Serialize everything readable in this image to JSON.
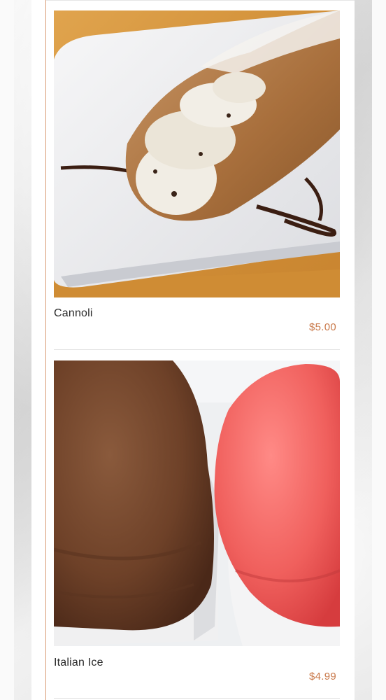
{
  "menu": {
    "items": [
      {
        "name": "Cannoli",
        "price": "$5.00"
      },
      {
        "name": "Italian Ice",
        "price": "$4.99"
      }
    ]
  },
  "colors": {
    "price_accent": "#c9794a",
    "accent_line": "#d99a73"
  }
}
